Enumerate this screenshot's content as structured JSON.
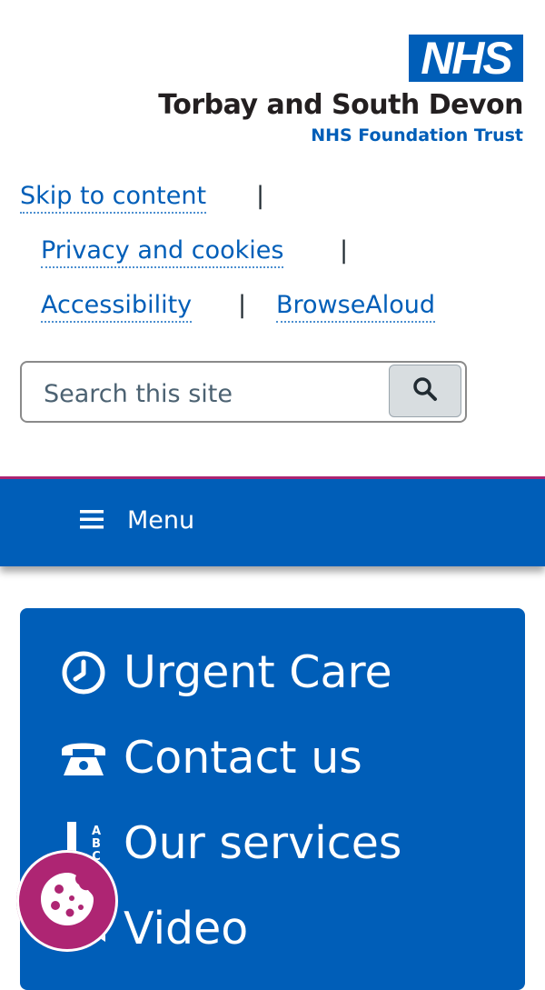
{
  "header": {
    "logo_text": "NHS",
    "org_name": "Torbay and South Devon",
    "org_subtitle": "NHS Foundation Trust"
  },
  "utility_links": {
    "skip": "Skip to content",
    "privacy": "Privacy and cookies",
    "accessibility": "Accessibility",
    "browsealoud": "BrowseAloud",
    "separator": "|"
  },
  "search": {
    "placeholder": "Search this site",
    "button_icon": "search-icon"
  },
  "nav": {
    "menu_label": "Menu",
    "menu_icon": "hamburger-icon"
  },
  "quick_links": [
    {
      "label": "Urgent Care",
      "icon": "clock-icon"
    },
    {
      "label": "Contact us",
      "icon": "telephone-icon"
    },
    {
      "label": "Our services",
      "icon": "directory-icon"
    },
    {
      "label": "Video",
      "icon": "video-icon"
    }
  ],
  "cookie_button": {
    "icon": "cookie-icon"
  },
  "colors": {
    "nhs_blue": "#005eb8",
    "accent_pink": "#ae2573",
    "text": "#212b32"
  }
}
